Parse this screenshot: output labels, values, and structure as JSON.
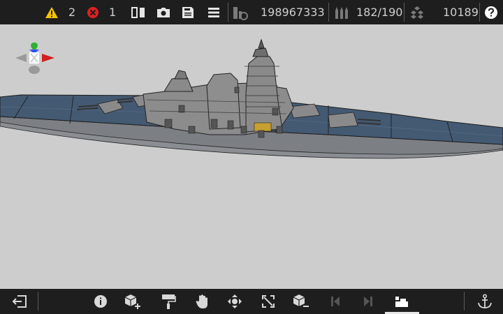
{
  "status": {
    "warnings": {
      "icon": "warning-icon",
      "count": "2",
      "color": "#f5c400"
    },
    "errors": {
      "icon": "error-icon",
      "count": "1",
      "color": "#e02020"
    }
  },
  "stats": {
    "blocks": {
      "icon": "block-count-icon",
      "value": "198967333"
    },
    "ammo": {
      "icon": "ammo-icon",
      "value": "182/190"
    },
    "cost": {
      "icon": "resources-icon",
      "value": "10189"
    }
  },
  "toolbar_top": [
    "mirror-icon",
    "camera-icon",
    "save-icon",
    "menu-icon",
    "help-icon"
  ],
  "toolbar_bottom": [
    "exit-icon",
    "info-icon",
    "add-block-icon",
    "paint-icon",
    "hand-icon",
    "move-icon",
    "resize-icon",
    "remove-block-icon",
    "step-back-icon",
    "step-forward-icon",
    "build-mode-icon",
    "anchor-icon"
  ],
  "gizmo": {
    "colors": {
      "x": "#d02020",
      "y": "#30b030",
      "z": "#3050ff"
    }
  },
  "colors": {
    "hull": "#445a73",
    "deck": "#3a4f68",
    "superstructure": "#8a8a8a",
    "bar": "#1e1e1e"
  }
}
